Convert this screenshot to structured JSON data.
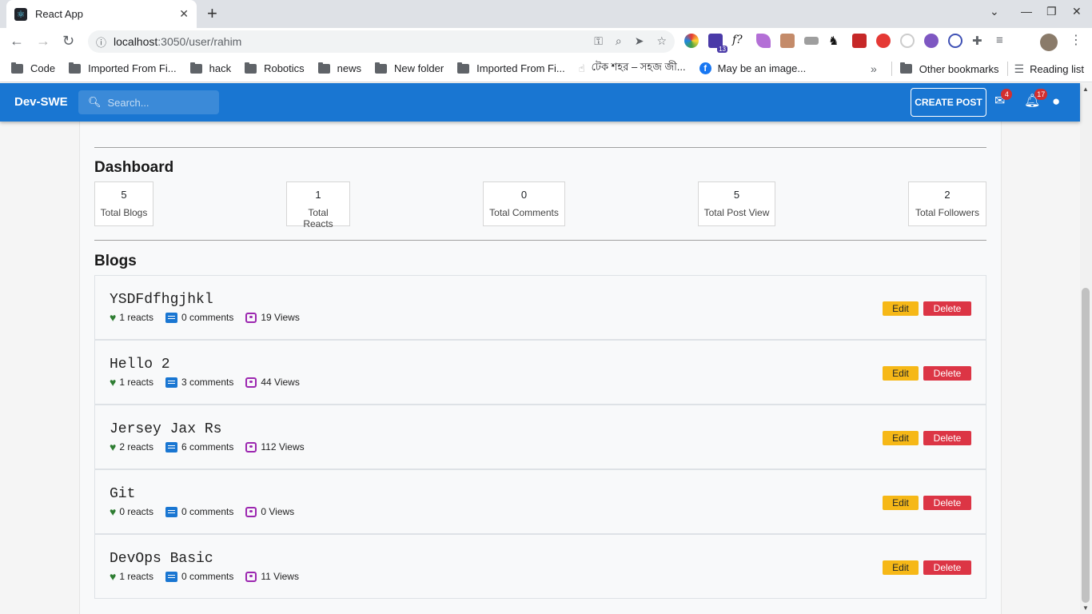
{
  "browser": {
    "tab_title": "React App",
    "url_host": "localhost",
    "url_rest": ":3050/user/rahim",
    "bookmarks": [
      "Code",
      "Imported From Fi...",
      "hack",
      "Robotics",
      "news",
      "New folder",
      "Imported From Fi...",
      "টেক শহর – সহজ জী...",
      "May be an image..."
    ],
    "other_bookmarks": "Other bookmarks",
    "reading_list": "Reading list",
    "ext_badge": "13"
  },
  "appbar": {
    "brand": "Dev-SWE",
    "search_placeholder": "Search...",
    "create_post": "CREATE POST",
    "mail_count": "4",
    "notif_count": "17"
  },
  "dashboard": {
    "title": "Dashboard",
    "stats": [
      {
        "value": "5",
        "label": "Total Blogs"
      },
      {
        "value": "1",
        "label": "Total Reacts"
      },
      {
        "value": "0",
        "label": "Total Comments"
      },
      {
        "value": "5",
        "label": "Total Post View"
      },
      {
        "value": "2",
        "label": "Total Followers"
      }
    ]
  },
  "blogs": {
    "title": "Blogs",
    "edit_label": "Edit",
    "delete_label": "Delete",
    "items": [
      {
        "title": "YSDFdfhgjhkl",
        "reacts": "1 reacts",
        "comments": "0 comments",
        "views": "19 Views"
      },
      {
        "title": "Hello 2",
        "reacts": "1 reacts",
        "comments": "3 comments",
        "views": "44 Views"
      },
      {
        "title": "Jersey Jax Rs",
        "reacts": "2 reacts",
        "comments": "6 comments",
        "views": "112 Views"
      },
      {
        "title": "Git",
        "reacts": "0 reacts",
        "comments": "0 comments",
        "views": "0 Views"
      },
      {
        "title": "DevOps Basic",
        "reacts": "1 reacts",
        "comments": "0 comments",
        "views": "11 Views"
      }
    ]
  }
}
